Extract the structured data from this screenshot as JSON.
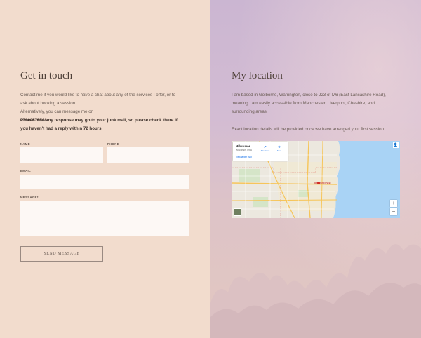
{
  "contact": {
    "title": "Get in touch",
    "intro_line1": "Contact me if you would like to have a chat about any of the services I offer, or to",
    "intro_line2": "ask about booking a session.",
    "intro_line3": "Alternatively, you can message me on",
    "phone_overlap": "07960575568",
    "notice_line1": "Please note any response may go to your junk mail, so please check there if",
    "notice_line2": "you haven't had a reply within 72 hours.",
    "form": {
      "name_label": "NAME",
      "phone_label": "PHONE",
      "email_label": "EMAIL",
      "message_label": "MESSAGE*",
      "submit_label": "SEND MESSAGE"
    }
  },
  "location": {
    "title": "My location",
    "para_line1": "I am based in Golborne, Warrington, close to J23 of M6 (East Lancashire Road),",
    "para_line2": "meaning I am easily accessible from Manchester, Liverpool, Cheshire, and",
    "para_line3": "surrounding areas.",
    "para2": "Exact location details will be provided once we have arranged your first session."
  },
  "map": {
    "place_name": "Milwaukee",
    "place_sub": "Wisconsin, USA",
    "view_larger": "View larger map",
    "directions_label": "Directions",
    "save_label": "Save",
    "city_label": "Milwaukee",
    "zoom_in": "+",
    "zoom_out": "−",
    "water_color": "#a9d3f5",
    "land_color": "#ece8df",
    "major_road_color": "#f6c55a",
    "border_color": "#e0766a"
  }
}
